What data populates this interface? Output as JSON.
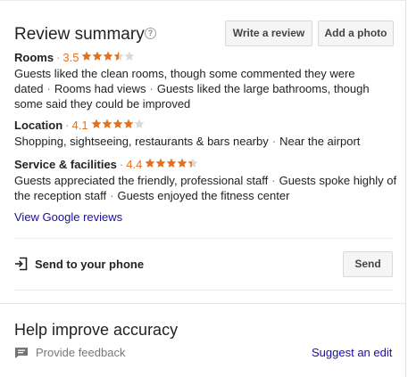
{
  "review_summary": {
    "title": "Review summary",
    "help_icon": "help-circle-icon",
    "write_review_label": "Write a review",
    "add_photo_label": "Add a photo",
    "categories": [
      {
        "name": "Rooms",
        "score": "3.5",
        "rating": 3.5,
        "description": [
          "Guests liked the clean rooms, though some commented they were dated",
          "Rooms had views",
          "Guests liked the large bathrooms, though some said they could be improved"
        ]
      },
      {
        "name": "Location",
        "score": "4.1",
        "rating": 4.1,
        "description": [
          "Shopping, sightseeing, restaurants & bars nearby",
          "Near the airport"
        ]
      },
      {
        "name": "Service & facilities",
        "score": "4.4",
        "rating": 4.4,
        "description": [
          "Guests appreciated the friendly, professional staff",
          "Guests spoke highly of the reception staff",
          "Guests enjoyed the fitness center"
        ]
      }
    ],
    "view_reviews_label": "View Google reviews"
  },
  "send_to_phone": {
    "icon": "send-to-device-icon",
    "label": "Send to your phone",
    "button_label": "Send"
  },
  "help_improve": {
    "title": "Help improve accuracy",
    "feedback_icon": "feedback-icon",
    "feedback_label": "Provide feedback",
    "suggest_label": "Suggest an edit"
  },
  "colors": {
    "star_filled": "#e7711b",
    "star_empty": "#d9d9d9",
    "link": "#1a0dab",
    "score": "#e7711b"
  }
}
